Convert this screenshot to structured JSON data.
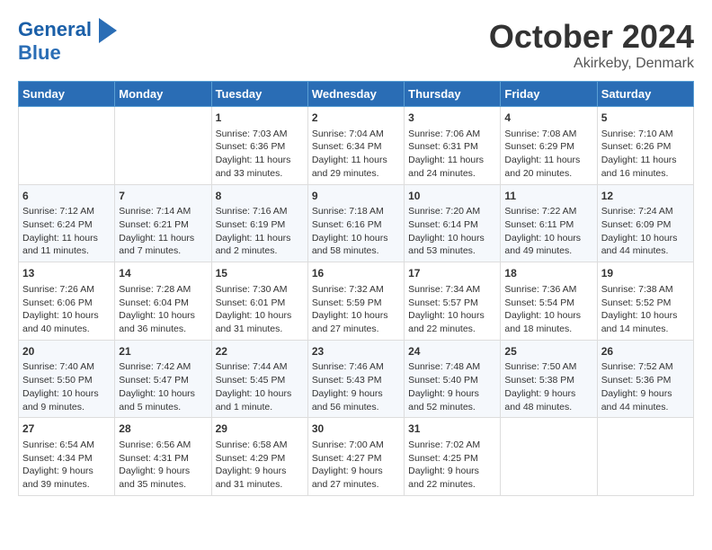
{
  "header": {
    "logo_line1": "General",
    "logo_line2": "Blue",
    "month": "October 2024",
    "location": "Akirkeby, Denmark"
  },
  "days_of_week": [
    "Sunday",
    "Monday",
    "Tuesday",
    "Wednesday",
    "Thursday",
    "Friday",
    "Saturday"
  ],
  "weeks": [
    [
      {
        "day": "",
        "content": ""
      },
      {
        "day": "",
        "content": ""
      },
      {
        "day": "1",
        "content": "Sunrise: 7:03 AM\nSunset: 6:36 PM\nDaylight: 11 hours and 33 minutes."
      },
      {
        "day": "2",
        "content": "Sunrise: 7:04 AM\nSunset: 6:34 PM\nDaylight: 11 hours and 29 minutes."
      },
      {
        "day": "3",
        "content": "Sunrise: 7:06 AM\nSunset: 6:31 PM\nDaylight: 11 hours and 24 minutes."
      },
      {
        "day": "4",
        "content": "Sunrise: 7:08 AM\nSunset: 6:29 PM\nDaylight: 11 hours and 20 minutes."
      },
      {
        "day": "5",
        "content": "Sunrise: 7:10 AM\nSunset: 6:26 PM\nDaylight: 11 hours and 16 minutes."
      }
    ],
    [
      {
        "day": "6",
        "content": "Sunrise: 7:12 AM\nSunset: 6:24 PM\nDaylight: 11 hours and 11 minutes."
      },
      {
        "day": "7",
        "content": "Sunrise: 7:14 AM\nSunset: 6:21 PM\nDaylight: 11 hours and 7 minutes."
      },
      {
        "day": "8",
        "content": "Sunrise: 7:16 AM\nSunset: 6:19 PM\nDaylight: 11 hours and 2 minutes."
      },
      {
        "day": "9",
        "content": "Sunrise: 7:18 AM\nSunset: 6:16 PM\nDaylight: 10 hours and 58 minutes."
      },
      {
        "day": "10",
        "content": "Sunrise: 7:20 AM\nSunset: 6:14 PM\nDaylight: 10 hours and 53 minutes."
      },
      {
        "day": "11",
        "content": "Sunrise: 7:22 AM\nSunset: 6:11 PM\nDaylight: 10 hours and 49 minutes."
      },
      {
        "day": "12",
        "content": "Sunrise: 7:24 AM\nSunset: 6:09 PM\nDaylight: 10 hours and 44 minutes."
      }
    ],
    [
      {
        "day": "13",
        "content": "Sunrise: 7:26 AM\nSunset: 6:06 PM\nDaylight: 10 hours and 40 minutes."
      },
      {
        "day": "14",
        "content": "Sunrise: 7:28 AM\nSunset: 6:04 PM\nDaylight: 10 hours and 36 minutes."
      },
      {
        "day": "15",
        "content": "Sunrise: 7:30 AM\nSunset: 6:01 PM\nDaylight: 10 hours and 31 minutes."
      },
      {
        "day": "16",
        "content": "Sunrise: 7:32 AM\nSunset: 5:59 PM\nDaylight: 10 hours and 27 minutes."
      },
      {
        "day": "17",
        "content": "Sunrise: 7:34 AM\nSunset: 5:57 PM\nDaylight: 10 hours and 22 minutes."
      },
      {
        "day": "18",
        "content": "Sunrise: 7:36 AM\nSunset: 5:54 PM\nDaylight: 10 hours and 18 minutes."
      },
      {
        "day": "19",
        "content": "Sunrise: 7:38 AM\nSunset: 5:52 PM\nDaylight: 10 hours and 14 minutes."
      }
    ],
    [
      {
        "day": "20",
        "content": "Sunrise: 7:40 AM\nSunset: 5:50 PM\nDaylight: 10 hours and 9 minutes."
      },
      {
        "day": "21",
        "content": "Sunrise: 7:42 AM\nSunset: 5:47 PM\nDaylight: 10 hours and 5 minutes."
      },
      {
        "day": "22",
        "content": "Sunrise: 7:44 AM\nSunset: 5:45 PM\nDaylight: 10 hours and 1 minute."
      },
      {
        "day": "23",
        "content": "Sunrise: 7:46 AM\nSunset: 5:43 PM\nDaylight: 9 hours and 56 minutes."
      },
      {
        "day": "24",
        "content": "Sunrise: 7:48 AM\nSunset: 5:40 PM\nDaylight: 9 hours and 52 minutes."
      },
      {
        "day": "25",
        "content": "Sunrise: 7:50 AM\nSunset: 5:38 PM\nDaylight: 9 hours and 48 minutes."
      },
      {
        "day": "26",
        "content": "Sunrise: 7:52 AM\nSunset: 5:36 PM\nDaylight: 9 hours and 44 minutes."
      }
    ],
    [
      {
        "day": "27",
        "content": "Sunrise: 6:54 AM\nSunset: 4:34 PM\nDaylight: 9 hours and 39 minutes."
      },
      {
        "day": "28",
        "content": "Sunrise: 6:56 AM\nSunset: 4:31 PM\nDaylight: 9 hours and 35 minutes."
      },
      {
        "day": "29",
        "content": "Sunrise: 6:58 AM\nSunset: 4:29 PM\nDaylight: 9 hours and 31 minutes."
      },
      {
        "day": "30",
        "content": "Sunrise: 7:00 AM\nSunset: 4:27 PM\nDaylight: 9 hours and 27 minutes."
      },
      {
        "day": "31",
        "content": "Sunrise: 7:02 AM\nSunset: 4:25 PM\nDaylight: 9 hours and 22 minutes."
      },
      {
        "day": "",
        "content": ""
      },
      {
        "day": "",
        "content": ""
      }
    ]
  ]
}
